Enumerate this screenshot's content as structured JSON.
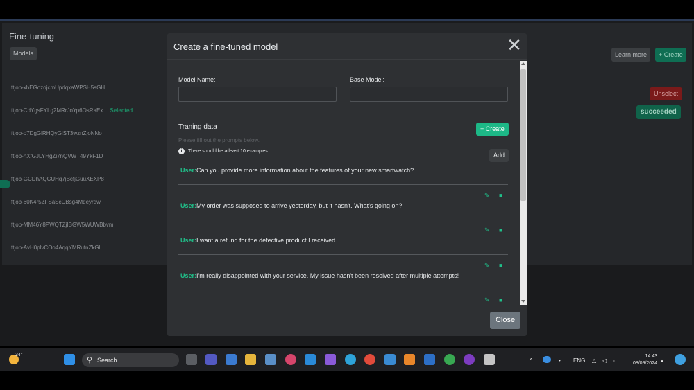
{
  "app": {
    "title": "Fine-tuning",
    "models_label": "Models",
    "learn_more_label": "Learn more",
    "create_label": "+ Create",
    "unselect_label": "Unselect",
    "status_label": "succeeded",
    "selected_tag": "Selected",
    "jobs": [
      "ftjob-xhEGozojcmUpdqxaWPSH5sGH",
      "ftjob-CdYgsFYLg2MRrJoYp6OsRaEx",
      "ftjob-o7DgGlRHQyGlST3wznZjoNNo",
      "ftjob-nXfGJLYHgZi7nQVWT49YkF1D",
      "ftjob-GCDhAQCUHq7jBcfjGuuXEXP8",
      "ftjob-60K4r5ZFSaScCBsg4Mdeyrdw",
      "ftjob-MM46Y8PWQTZjIBGW5WUWBbvm",
      "ftjob-AvH0plvCOo4AqqYMRufnZkGl"
    ]
  },
  "modal": {
    "title": "Create a fine-tuned model",
    "model_name_label": "Model Name:",
    "model_name_value": "",
    "base_model_label": "Base Model:",
    "base_model_value": "",
    "training_title": "Traning data",
    "create_label": "+ Create",
    "hint": "Please fill out the prompts below.",
    "info": "There should be atleast 10 examples.",
    "add_label": "Add",
    "user_prefix": "User:",
    "prompts": [
      "Can you provide more information about the features of your new smartwatch?",
      "My order was supposed to arrive yesterday, but it hasn't. What's going on?",
      "I want a refund for the defective product I received.",
      "I'm really disappointed with your service. My issue hasn't been resolved after multiple attempts!"
    ],
    "close_label": "Close"
  },
  "taskbar": {
    "weather": "34°",
    "search_label": "Search",
    "language": "ENG",
    "time": "14:43",
    "date": "08/09/2024"
  }
}
